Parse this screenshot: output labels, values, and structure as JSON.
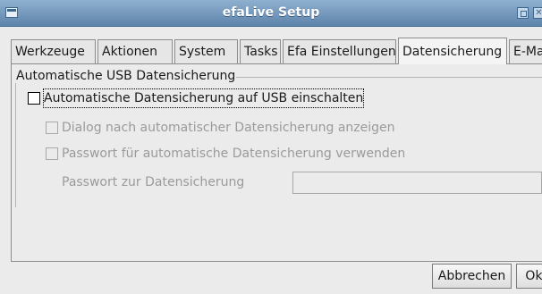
{
  "window": {
    "title": "efaLive Setup"
  },
  "tabs": [
    {
      "label": "Werkzeuge",
      "active": false
    },
    {
      "label": "Aktionen",
      "active": false
    },
    {
      "label": "System",
      "active": false
    },
    {
      "label": "Tasks",
      "active": false
    },
    {
      "label": "Efa Einstellungen",
      "active": false
    },
    {
      "label": "Datensicherung",
      "active": true
    },
    {
      "label": "E-Mail",
      "active": false
    }
  ],
  "usb_backup": {
    "group_title": "Automatische USB Datensicherung",
    "enable_label": "Automatische Datensicherung auf USB einschalten",
    "enable_checked": false,
    "dialog_label": "Dialog nach automatischer Datensicherung anzeigen",
    "dialog_checked": false,
    "password_toggle_label": "Passwort für automatische Datensicherung verwenden",
    "password_toggle_checked": false,
    "password_label": "Passwort zur Datensicherung",
    "password_value": ""
  },
  "buttons": {
    "cancel": "Abbrechen",
    "ok": "Ok"
  },
  "colors": {
    "titlebar": "#5e84aa",
    "window_bg": "#ebebeb",
    "disabled_text": "#9a9a9a"
  }
}
